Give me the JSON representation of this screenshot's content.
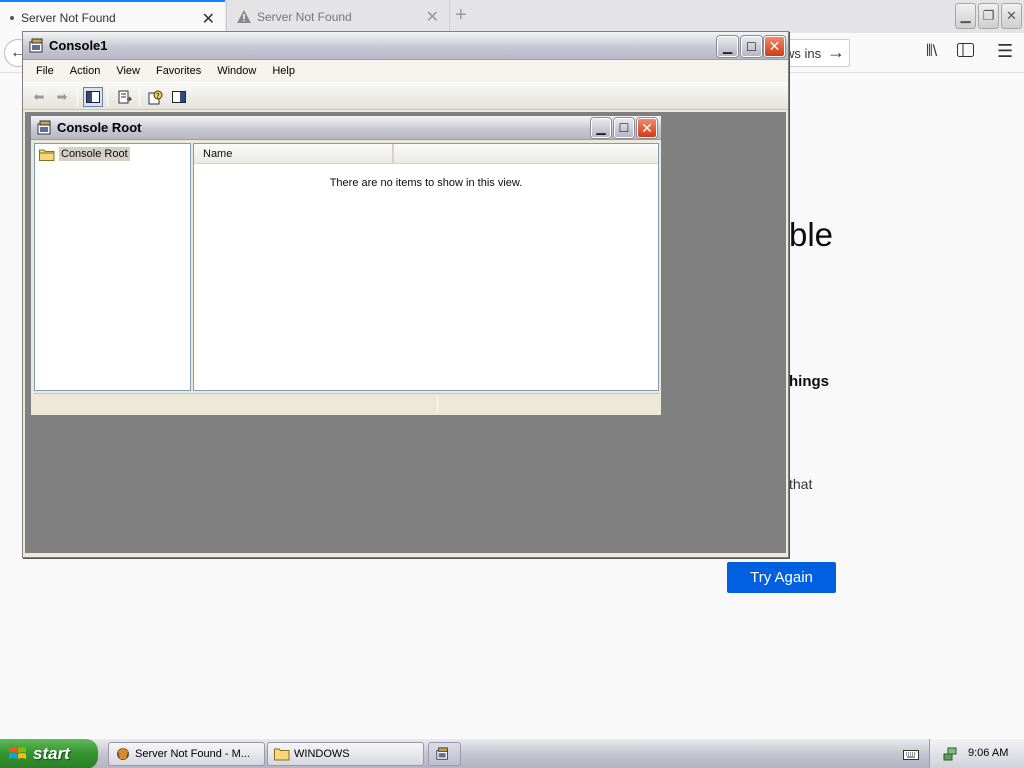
{
  "firefox": {
    "tabs": [
      {
        "label": "Server Not Found",
        "active": true
      },
      {
        "label": "Server Not Found",
        "active": false
      }
    ],
    "new_tab_glyph": "+",
    "url_fragment": "ws ins",
    "page": {
      "title_fragment": "ble",
      "subtitle_fragment": "hings",
      "body_fragment": "that",
      "try_again_label": "Try Again"
    }
  },
  "console1": {
    "title": "Console1",
    "menu": [
      "File",
      "Action",
      "View",
      "Favorites",
      "Window",
      "Help"
    ]
  },
  "console_root": {
    "title": "Console Root",
    "tree_item": "Console Root",
    "column_name": "Name",
    "empty_message": "There are no items to show in this view."
  },
  "taskbar": {
    "start_label": "start",
    "tasks": [
      {
        "label": "Server Not Found - M..."
      },
      {
        "label": "WINDOWS"
      }
    ],
    "clock": "9:06 AM"
  },
  "colors": {
    "firefox_accent": "#0a84ff",
    "try_again_bg": "#0060df",
    "mmc_client_bg": "#808080",
    "xp_close_red": "#d23a16",
    "start_green": "#33932e"
  },
  "icons": [
    "warning-icon",
    "back-arrow-icon",
    "forward-arrow-icon",
    "library-icon",
    "sidebar-icon",
    "hamburger-menu-icon",
    "mmc-console-icon",
    "folder-icon",
    "windows-flag-icon",
    "firefox-icon",
    "keyboard-icon",
    "network-icon"
  ]
}
